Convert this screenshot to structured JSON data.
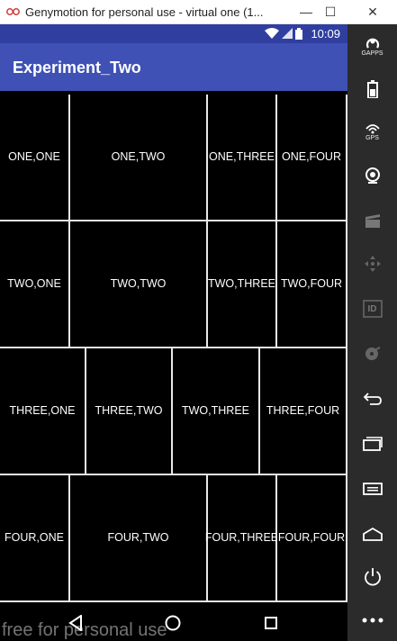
{
  "window": {
    "title": "Genymotion for personal use - virtual one (1...",
    "minimize_glyph": "—",
    "maximize_glyph": "☐",
    "close_glyph": "✕"
  },
  "statusbar": {
    "time": "10:09"
  },
  "appbar": {
    "title": "Experiment_Two",
    "color": "#3F51B5",
    "status_color": "#303F9F"
  },
  "grid": {
    "rows": [
      [
        "ONE,ONE",
        "ONE,TWO",
        "ONE,THREE",
        "ONE,FOUR"
      ],
      [
        "TWO,ONE",
        "TWO,TWO",
        "TWO,THREE",
        "TWO,FOUR"
      ],
      [
        "THREE,ONE",
        "THREE,TWO",
        "TWO,THREE",
        "THREE,FOUR"
      ],
      [
        "FOUR,ONE",
        "FOUR,TWO",
        "FOUR,THREE",
        "FOUR,FOUR"
      ]
    ]
  },
  "navbar": {
    "watermark": "free for personal use"
  },
  "sidepanel": {
    "items": [
      {
        "name": "gapps",
        "label": "GAPPS"
      },
      {
        "name": "battery",
        "label": ""
      },
      {
        "name": "gps",
        "label": "GPS"
      },
      {
        "name": "webcam",
        "label": ""
      },
      {
        "name": "media",
        "label": ""
      },
      {
        "name": "move",
        "label": ""
      },
      {
        "name": "identifier",
        "label": "ID"
      },
      {
        "name": "disk",
        "label": ""
      },
      {
        "name": "back",
        "label": ""
      },
      {
        "name": "recent-apps",
        "label": ""
      },
      {
        "name": "menu",
        "label": ""
      },
      {
        "name": "home",
        "label": ""
      },
      {
        "name": "power",
        "label": ""
      },
      {
        "name": "more",
        "label": ""
      }
    ]
  }
}
